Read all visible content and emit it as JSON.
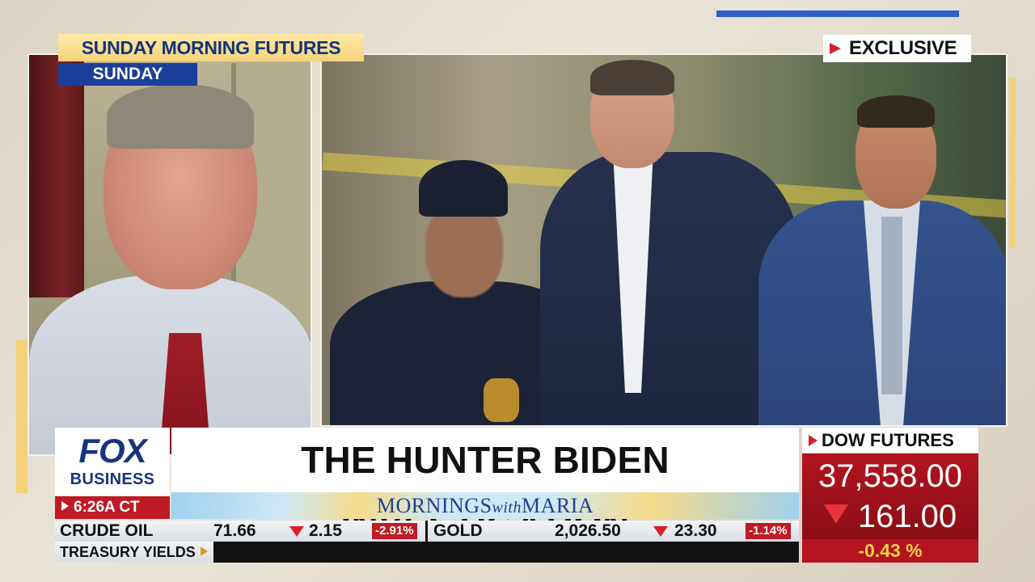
{
  "show": {
    "title": "SUNDAY MORNING FUTURES",
    "day": "SUNDAY",
    "tag": "EXCLUSIVE",
    "strip_name_main": "MORNINGS",
    "strip_name_with": "with",
    "strip_name_host": "MARIA"
  },
  "network": {
    "logo_top": "FOX",
    "logo_bottom": "BUSINESS",
    "time": "6:26A CT"
  },
  "headline": "THE HUNTER BIDEN INVESTIGATION",
  "ticker": {
    "items": [
      {
        "name": "CRUDE OIL",
        "price": "71.66",
        "change": "2.15",
        "pct": "-2.91%",
        "direction": "down"
      },
      {
        "name": "GOLD",
        "price": "2,026.50",
        "change": "23.30",
        "pct": "-1.14%",
        "direction": "down"
      }
    ],
    "next_label": "TREASURY YIELDS"
  },
  "dow": {
    "label": "DOW FUTURES",
    "value": "37,558.00",
    "change": "161.00",
    "pct": "-0.43 %",
    "direction": "down"
  },
  "colors": {
    "fox_blue": "#17357f",
    "alert_red": "#c01a24",
    "show_gold": "#f4d37c",
    "pct_yellow": "#f4cf4a"
  }
}
